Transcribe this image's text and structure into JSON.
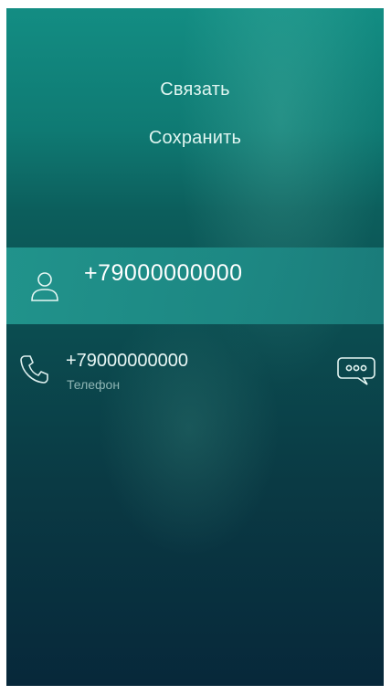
{
  "pulley_menu": {
    "items": [
      {
        "label": "Связать"
      },
      {
        "label": "Сохранить"
      }
    ]
  },
  "header": {
    "phone_number": "+79000000000",
    "avatar_icon": "person-icon"
  },
  "details": {
    "phone": {
      "number": "+79000000000",
      "type_label": "Телефон",
      "icon": "phone-icon",
      "action_icon": "message-bubble-icon"
    }
  },
  "colors": {
    "accent": "#22968e",
    "background_top": "#138d83",
    "background_bottom": "#07283a",
    "primary_text": "#ffffff",
    "secondary_text": "#8fb6b5"
  }
}
